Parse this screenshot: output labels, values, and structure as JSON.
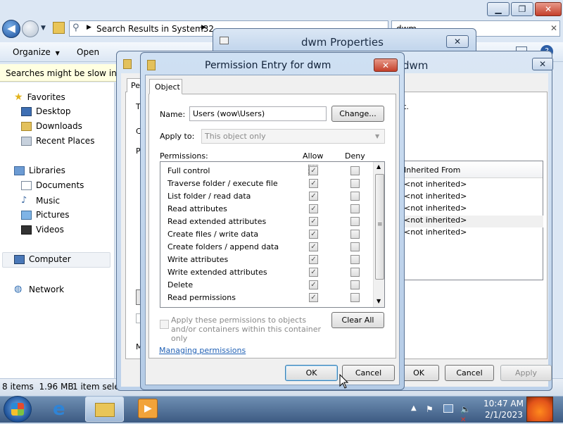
{
  "explorer": {
    "address": "Search Results in System32",
    "search_value": "dwm",
    "toolbar": {
      "organize": "Organize",
      "open": "Open"
    },
    "info_bar": "Searches might be slow in nor",
    "nav": {
      "favorites": "Favorites",
      "desktop": "Desktop",
      "downloads": "Downloads",
      "recent": "Recent Places",
      "libraries": "Libraries",
      "documents": "Documents",
      "music": "Music",
      "pictures": "Pictures",
      "videos": "Videos",
      "computer": "Computer",
      "network": "Network"
    },
    "status_items": "8 items  1.96 MB",
    "status_selected": "1 item selec"
  },
  "properties": {
    "title": "dwm Properties"
  },
  "security_dialog": {
    "title_suffix": "dwm",
    "tab_fragment": "Pe",
    "text_t": "T",
    "text_c": "C",
    "text_p": "P",
    "text_m": "M",
    "text_dot": "t.",
    "inherited_header": "Inherited From",
    "inherited_rows": [
      "<not inherited>",
      "<not inherited>",
      "<not inherited>",
      "<not inherited>",
      "<not inherited>"
    ],
    "ok": "OK",
    "cancel": "Cancel",
    "apply": "Apply"
  },
  "permission_entry": {
    "title": "Permission Entry for dwm",
    "tab": "Object",
    "name_label": "Name:",
    "name_value": "Users (wow\\Users)",
    "change_button": "Change...",
    "apply_to_label": "Apply to:",
    "apply_to_value": "This object only",
    "permissions_label": "Permissions:",
    "allow_header": "Allow",
    "deny_header": "Deny",
    "permissions": [
      {
        "name": "Full control",
        "allow": true,
        "deny": false
      },
      {
        "name": "Traverse folder / execute file",
        "allow": true,
        "deny": false
      },
      {
        "name": "List folder / read data",
        "allow": true,
        "deny": false
      },
      {
        "name": "Read attributes",
        "allow": true,
        "deny": false
      },
      {
        "name": "Read extended attributes",
        "allow": true,
        "deny": false
      },
      {
        "name": "Create files / write data",
        "allow": true,
        "deny": false
      },
      {
        "name": "Create folders / append data",
        "allow": true,
        "deny": false
      },
      {
        "name": "Write attributes",
        "allow": true,
        "deny": false
      },
      {
        "name": "Write extended attributes",
        "allow": true,
        "deny": false
      },
      {
        "name": "Delete",
        "allow": true,
        "deny": false
      },
      {
        "name": "Read permissions",
        "allow": true,
        "deny": false
      }
    ],
    "apply_inherit_text": "Apply these permissions to objects and/or containers within this container only",
    "clear_all": "Clear All",
    "managing_link": "Managing permissions",
    "ok": "OK",
    "cancel": "Cancel"
  },
  "taskbar": {
    "time": "10:47 AM",
    "date": "2/1/2023"
  }
}
